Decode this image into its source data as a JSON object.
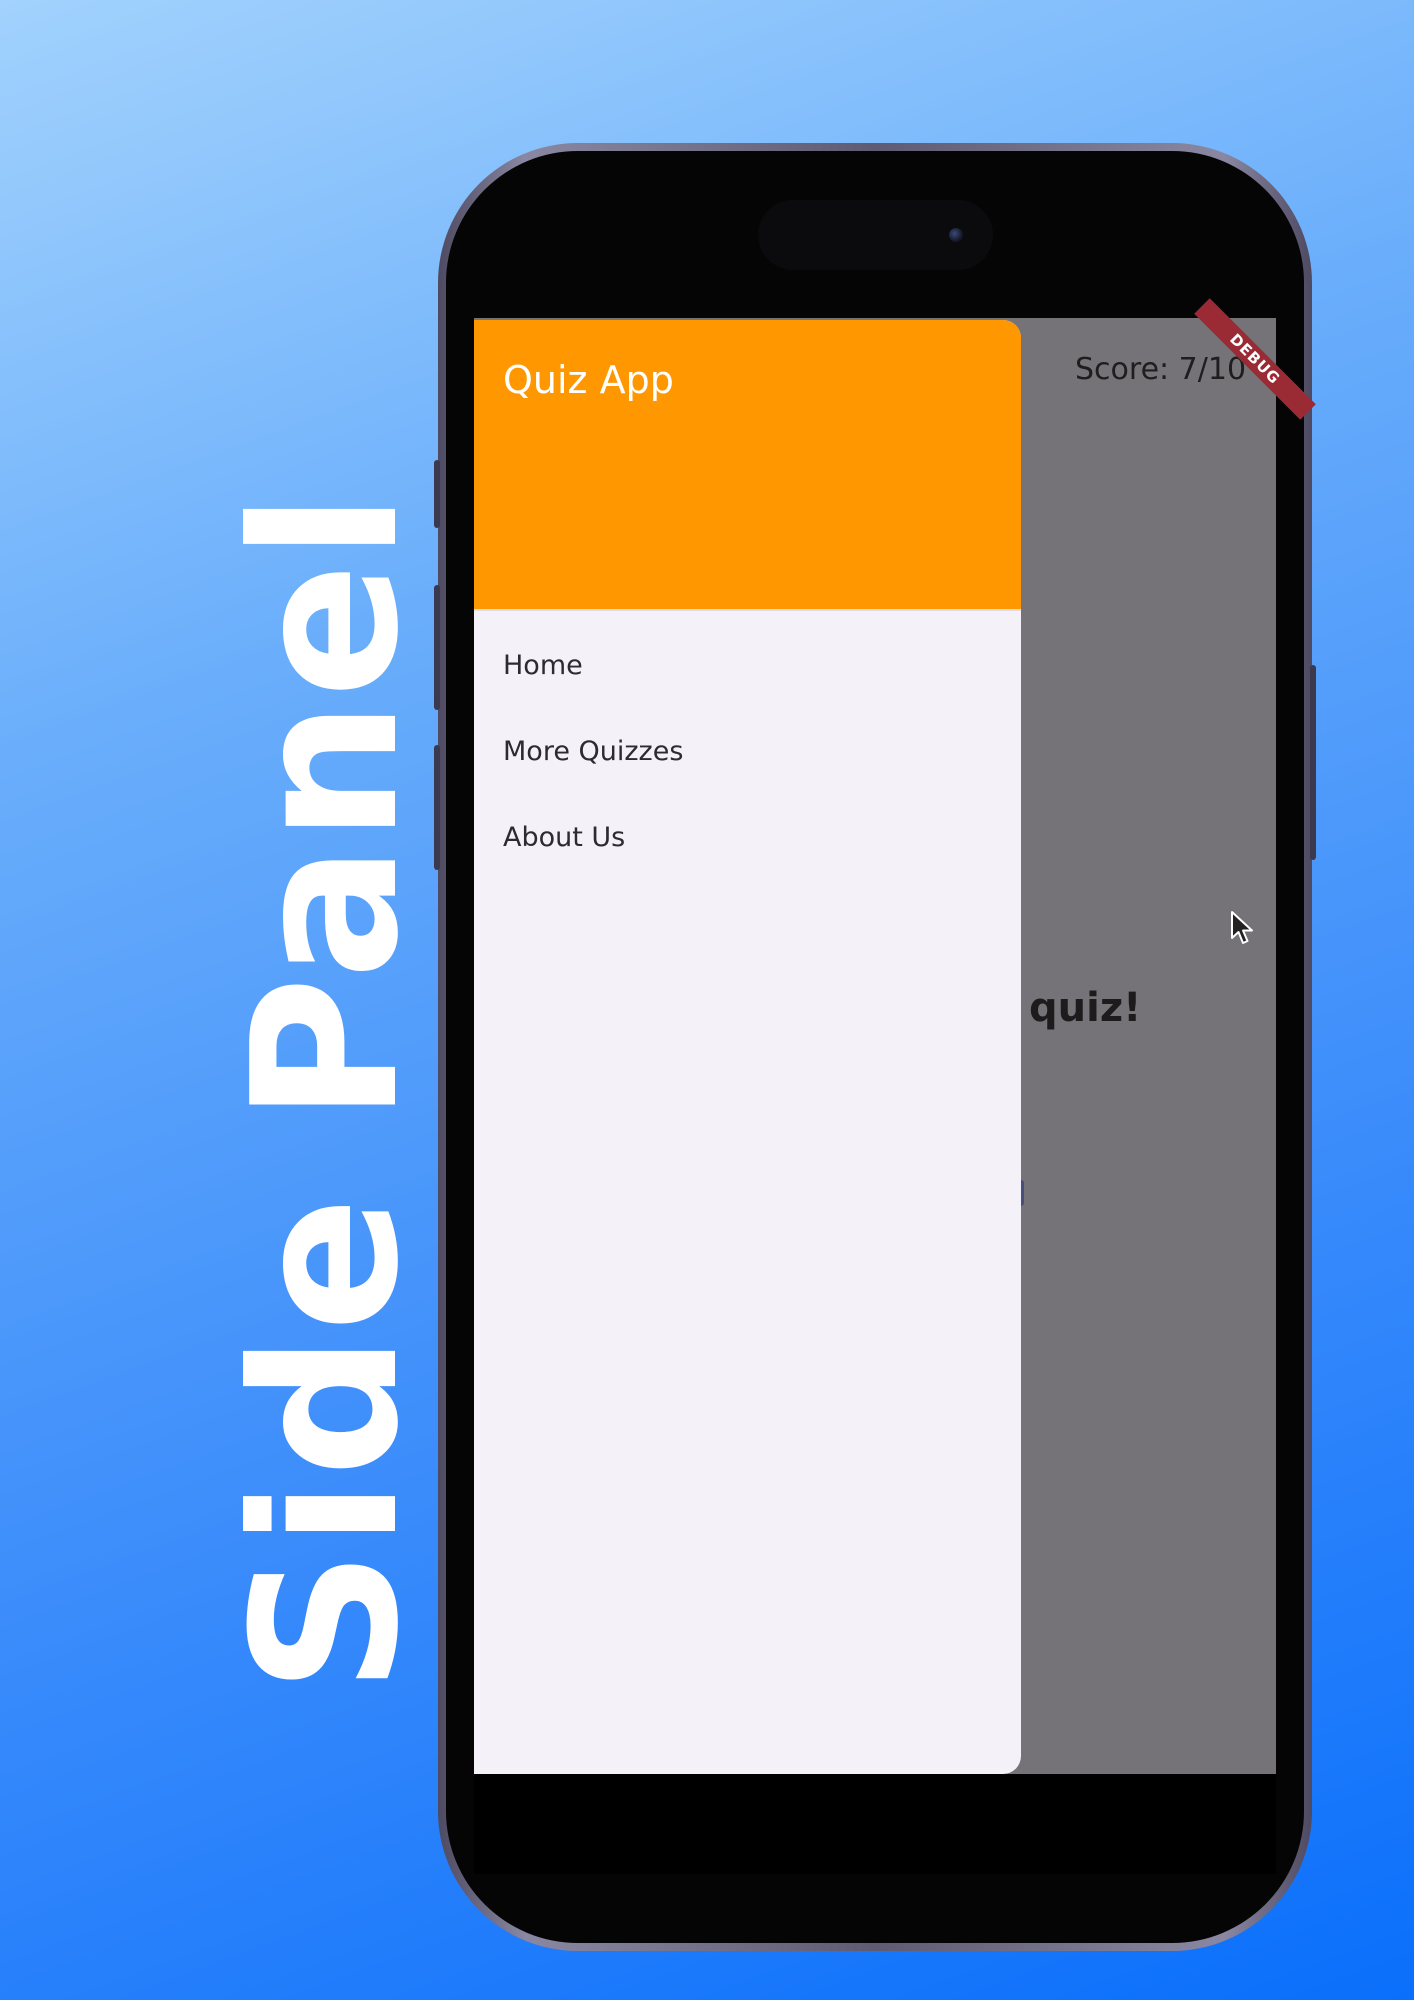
{
  "banner": {
    "title": "Side Panel"
  },
  "app": {
    "score_text": "Score: 7/10",
    "background_text": "quiz!",
    "debug_label": "DEBUG"
  },
  "drawer": {
    "header_title": "Quiz App",
    "header_color": "#ff9700",
    "items": [
      {
        "label": "Home"
      },
      {
        "label": "More Quizzes"
      },
      {
        "label": "About Us"
      }
    ]
  },
  "icons": {
    "cursor": "mouse-pointer-icon",
    "camera": "front-camera-icon"
  }
}
